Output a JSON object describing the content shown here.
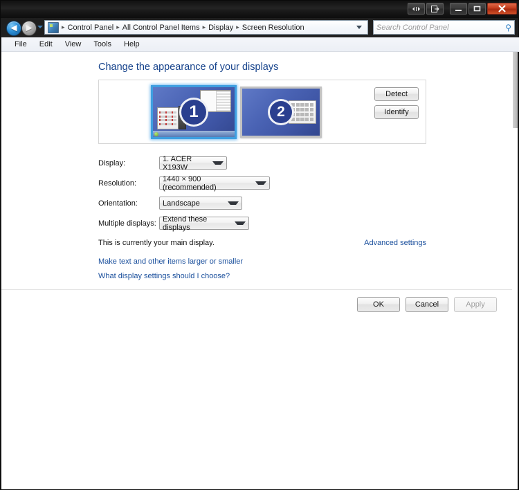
{
  "window": {
    "controls": [
      {
        "name": "restore-size-button",
        "glyph": "◂▸"
      },
      {
        "name": "detach-button",
        "glyph": "⬚"
      },
      {
        "name": "minimize-button",
        "glyph": "—"
      },
      {
        "name": "maximize-button",
        "glyph": "❐"
      },
      {
        "name": "close-button",
        "glyph": "✕"
      }
    ]
  },
  "navigation": {
    "back_glyph": "◀",
    "forward_glyph": "▶",
    "refresh_glyph": "↻",
    "breadcrumbs": [
      "Control Panel",
      "All Control Panel Items",
      "Display",
      "Screen Resolution"
    ],
    "separator": "▸"
  },
  "search": {
    "placeholder": "Search Control Panel",
    "value": "",
    "icon_glyph": "⚲"
  },
  "menubar": {
    "items": [
      "File",
      "Edit",
      "View",
      "Tools",
      "Help"
    ]
  },
  "page": {
    "heading": "Change the appearance of your displays"
  },
  "preview": {
    "monitors": [
      {
        "number": "1",
        "selected": true
      },
      {
        "number": "2",
        "selected": false
      }
    ],
    "buttons": [
      {
        "label": "Detect",
        "name": "detect-button"
      },
      {
        "label": "Identify",
        "name": "identify-button"
      }
    ]
  },
  "form": {
    "display": {
      "label": "Display:",
      "value": "1. ACER X193W"
    },
    "resolution": {
      "label": "Resolution:",
      "value": "1440 × 900 (recommended)"
    },
    "orientation": {
      "label": "Orientation:",
      "value": "Landscape"
    },
    "multiple_displays": {
      "label": "Multiple displays:",
      "value": "Extend these displays"
    }
  },
  "status": {
    "main_display_text": "This is currently your main display.",
    "advanced_settings_link": "Advanced settings"
  },
  "links": [
    "Make text and other items larger or smaller",
    "What display settings should I choose?"
  ],
  "footer": {
    "ok_label": "OK",
    "cancel_label": "Cancel",
    "apply_label": "Apply"
  },
  "colors": {
    "heading": "#15428b",
    "link": "#1a4f9c",
    "selection": "#3f9fe0",
    "close_button": "#c33c1c"
  }
}
